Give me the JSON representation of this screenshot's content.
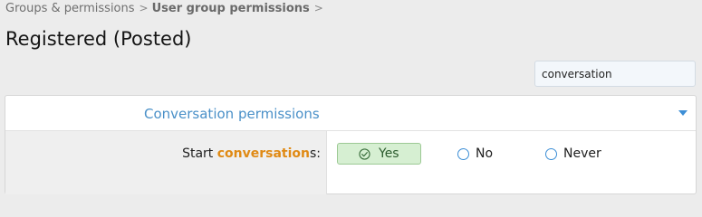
{
  "breadcrumb": {
    "items": [
      "Groups & permissions",
      "User group permissions"
    ],
    "separator": ">"
  },
  "page": {
    "title": "Registered (Posted)"
  },
  "search": {
    "value": "conversation"
  },
  "panel": {
    "title": "Conversation permissions",
    "rows": [
      {
        "label_prefix": "Start ",
        "label_highlight": "conversation",
        "label_suffix": "s:",
        "options": [
          "Yes",
          "No",
          "Never"
        ],
        "selected": "Yes"
      }
    ]
  },
  "colors": {
    "link_blue": "#4a90c8",
    "highlight_orange": "#e08a14",
    "selected_green_bg": "#d6efd2",
    "radio_blue": "#3d8fd6"
  },
  "icons": {
    "breadcrumb_separator": "chevron-right-icon",
    "collapse": "caret-down-icon",
    "selected_option": "check-circle-icon",
    "unselected_option": "radio-empty-icon"
  }
}
